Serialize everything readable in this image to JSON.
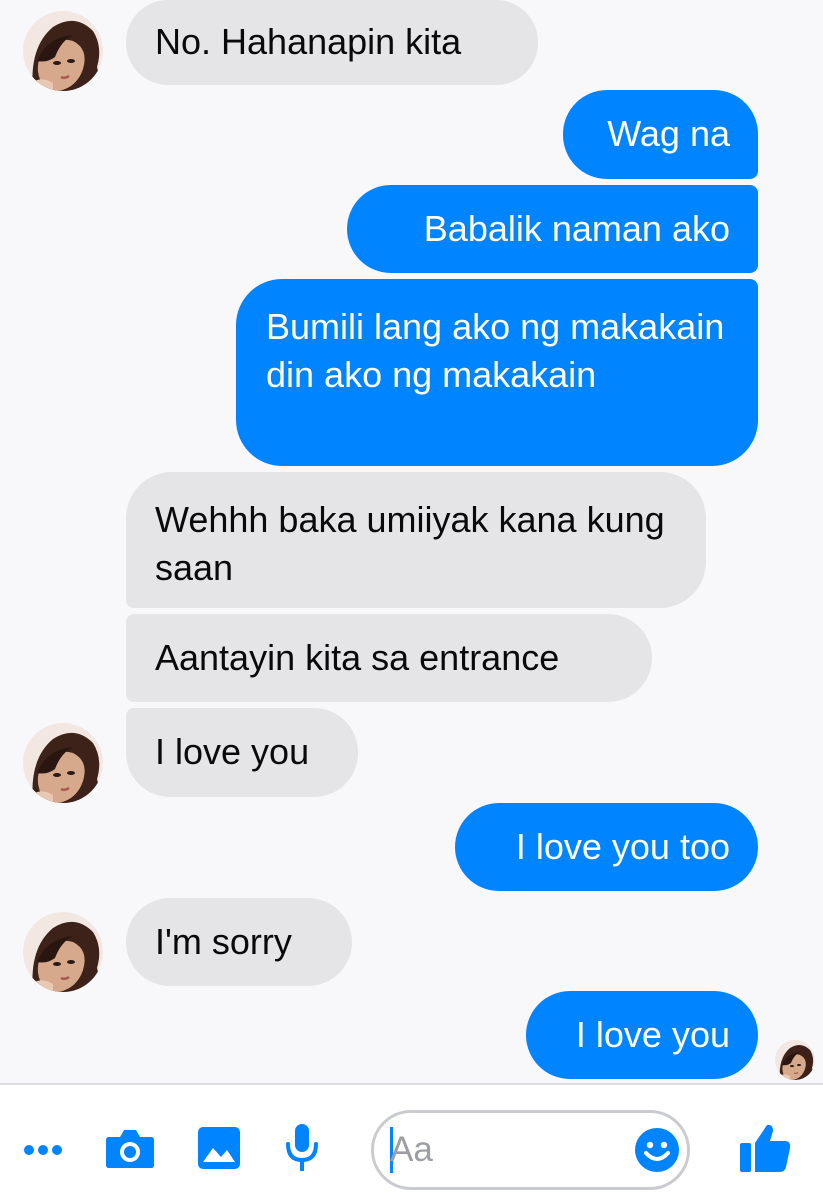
{
  "messages": [
    {
      "side": "in",
      "text": "No. Hahanapin kita"
    },
    {
      "side": "out",
      "text": "Wag na"
    },
    {
      "side": "out",
      "text": "Babalik naman ako"
    },
    {
      "side": "out",
      "text": "Bumili lang ako ng makakain din ako ng makakain"
    },
    {
      "side": "in",
      "text": "Wehhh baka umiiyak kana kung saan"
    },
    {
      "side": "in",
      "text": "Aantayin kita sa entrance"
    },
    {
      "side": "in",
      "text": "I love you"
    },
    {
      "side": "out",
      "text": "I love you too"
    },
    {
      "side": "in",
      "text": "I'm sorry"
    },
    {
      "side": "out",
      "text": "I love you"
    }
  ],
  "composer": {
    "placeholder": "Aa",
    "value": "",
    "tools": [
      "more-icon",
      "camera-icon",
      "gallery-icon",
      "microphone-icon"
    ],
    "emoji_icon": "smiley-icon",
    "send_icon": "thumbs-up-icon"
  },
  "colors": {
    "accent": "#0084ff",
    "incoming_bubble": "#e5e5e8",
    "background": "#f8f8fa"
  }
}
